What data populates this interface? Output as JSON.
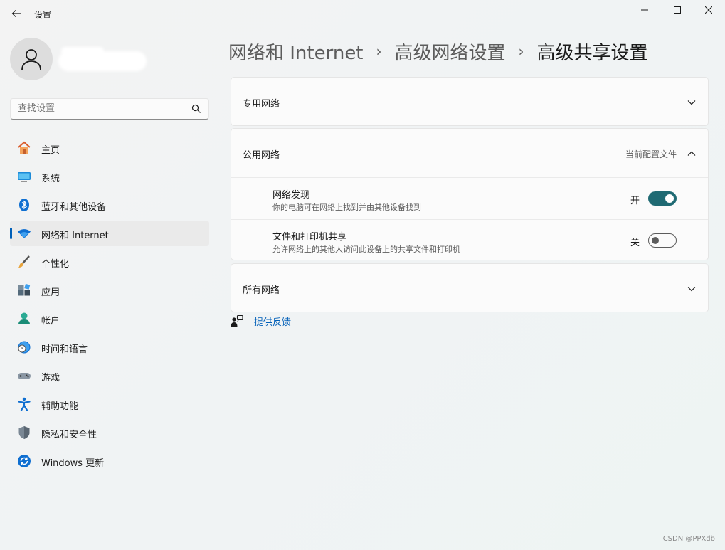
{
  "window": {
    "title": "设置"
  },
  "user": {
    "avatar_icon": "person-icon"
  },
  "search": {
    "placeholder": "查找设置"
  },
  "nav": {
    "items": [
      {
        "label": "主页",
        "icon": "home-icon",
        "active": false
      },
      {
        "label": "系统",
        "icon": "monitor-icon",
        "active": false
      },
      {
        "label": "蓝牙和其他设备",
        "icon": "bluetooth-icon",
        "active": false
      },
      {
        "label": "网络和 Internet",
        "icon": "wifi-icon",
        "active": true
      },
      {
        "label": "个性化",
        "icon": "brush-icon",
        "active": false
      },
      {
        "label": "应用",
        "icon": "apps-icon",
        "active": false
      },
      {
        "label": "帐户",
        "icon": "account-icon",
        "active": false
      },
      {
        "label": "时间和语言",
        "icon": "globe-clock-icon",
        "active": false
      },
      {
        "label": "游戏",
        "icon": "gamepad-icon",
        "active": false
      },
      {
        "label": "辅助功能",
        "icon": "accessibility-icon",
        "active": false
      },
      {
        "label": "隐私和安全性",
        "icon": "shield-icon",
        "active": false
      },
      {
        "label": "Windows 更新",
        "icon": "update-icon",
        "active": false
      }
    ]
  },
  "breadcrumb": {
    "items": [
      "网络和 Internet",
      "高级网络设置",
      "高级共享设置"
    ],
    "separator": "›"
  },
  "sections": {
    "private": {
      "title": "专用网络"
    },
    "public": {
      "title": "公用网络",
      "status": "当前配置文件",
      "rows": [
        {
          "title": "网络发现",
          "desc": "你的电脑可在网络上找到并由其他设备找到",
          "state_label": "开",
          "on": true
        },
        {
          "title": "文件和打印机共享",
          "desc": "允许网络上的其他人访问此设备上的共享文件和打印机",
          "state_label": "关",
          "on": false
        }
      ]
    },
    "all": {
      "title": "所有网络"
    }
  },
  "feedback": {
    "label": "提供反馈"
  },
  "watermark": "CSDN @PPXdb",
  "colors": {
    "accent": "#005fb8",
    "toggle_on": "#1f6a73"
  }
}
